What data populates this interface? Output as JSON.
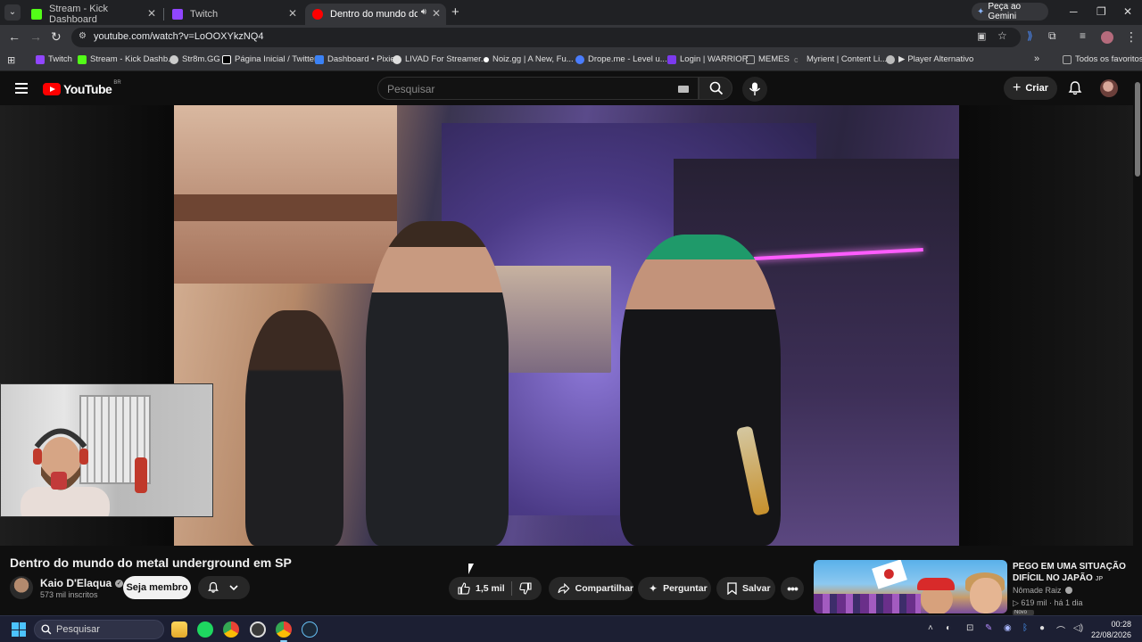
{
  "browser": {
    "tabs": [
      {
        "title": "Stream - Kick Dashboard",
        "favicon_color": "#53fc18"
      },
      {
        "title": "Twitch",
        "favicon_color": "#9146ff"
      },
      {
        "title": "Dentro do mundo do metal",
        "favicon_color": "#ff0000"
      }
    ],
    "new_tab_icon": "plus-icon",
    "gemini_label": "Peça ao Gemini",
    "url": "youtube.com/watch?v=LoOOXYkzNQ4",
    "bookmarks": [
      {
        "label": "Twitch",
        "color": "#9146ff"
      },
      {
        "label": "Stream - Kick Dashb...",
        "color": "#53fc18"
      },
      {
        "label": "Str8m.GG",
        "color": "#cccccc"
      },
      {
        "label": "Página Inicial / Twitter",
        "color": "#ffffff"
      },
      {
        "label": "Dashboard • Pixie",
        "color": "#3b82f6"
      },
      {
        "label": "LIVAD For Streamer...",
        "color": "#dddddd"
      },
      {
        "label": "Noiz.gg | A New, Fu...",
        "color": "#ffffff"
      },
      {
        "label": "Drope.me - Level u...",
        "color": "#4a7dff"
      },
      {
        "label": "Login | WARRIOR",
        "color": "#7c3aed"
      },
      {
        "label": "MEMES",
        "color": "#aaaaaa"
      },
      {
        "label": "Myrient | Content Li...",
        "color": "#888888"
      },
      {
        "label": "Player Alternativo",
        "color": "#bbbbbb"
      }
    ],
    "all_bookmarks_label": "Todos os favoritos"
  },
  "youtube": {
    "logo_text": "YouTube",
    "region": "BR",
    "search_placeholder": "Pesquisar",
    "create_label": "Criar",
    "video": {
      "title": "Dentro do mundo do metal underground em SP",
      "channel": "Kaio D'Elaqua",
      "subscribers": "573 mil inscritos",
      "join_label": "Seja membro",
      "likes": "1,5 mil",
      "share_label": "Compartilhar",
      "ask_label": "Perguntar",
      "save_label": "Salvar"
    },
    "recommendation": {
      "title": "PEGO EM UMA SITUAÇÃO DIFÍCIL NO JAPÃO",
      "title_tag": "JP",
      "channel": "Nômade Raiz",
      "views": "619 mil",
      "age": "há 1 dia",
      "badge": "Novo"
    }
  },
  "taskbar": {
    "search_placeholder": "Pesquisar",
    "time": "00:28",
    "date": "22/08/2026"
  },
  "colors": {
    "yt_bg": "#0f0f0f",
    "yt_red": "#ff0000",
    "chrome_toolbar": "#35363a",
    "taskbar": "#1c1f33"
  }
}
